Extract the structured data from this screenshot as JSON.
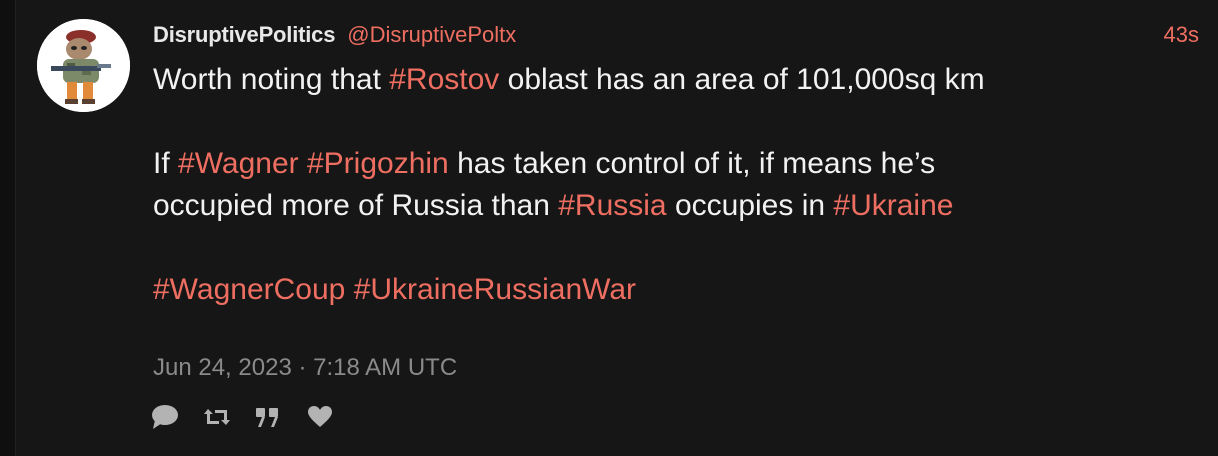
{
  "tweet": {
    "author": {
      "fullname": "DisruptivePolitics",
      "handle": "@DisruptivePoltx"
    },
    "time_ago": "43s",
    "content": {
      "line1": {
        "t1": "Worth noting that ",
        "tag1": "#Rostov",
        "t2": " oblast has an area of 101,000sq km"
      },
      "line2": {
        "t1": "If ",
        "tag1": "#Wagner",
        "t2": " ",
        "tag2": "#Prigozhin",
        "t3": " has taken control of it, if means he’s"
      },
      "line3": {
        "t1": "occupied more of Russia than ",
        "tag1": "#Russia",
        "t2": " occupies in ",
        "tag2": "#Ukraine"
      },
      "line4": {
        "tag1": "#WagnerCoup",
        "t1": " ",
        "tag2": "#UkraineRussianWar"
      }
    },
    "date": "Jun 24, 2023 · 7:18 AM UTC",
    "actions": {
      "reply_icon": "comment-icon",
      "retweet_icon": "retweet-icon",
      "quote_icon": "quote-icon",
      "like_icon": "heart-icon"
    }
  },
  "colors": {
    "background": "#161616",
    "text": "#f2f2f2",
    "accent": "#ee6e61",
    "muted": "#8a8a8a"
  }
}
